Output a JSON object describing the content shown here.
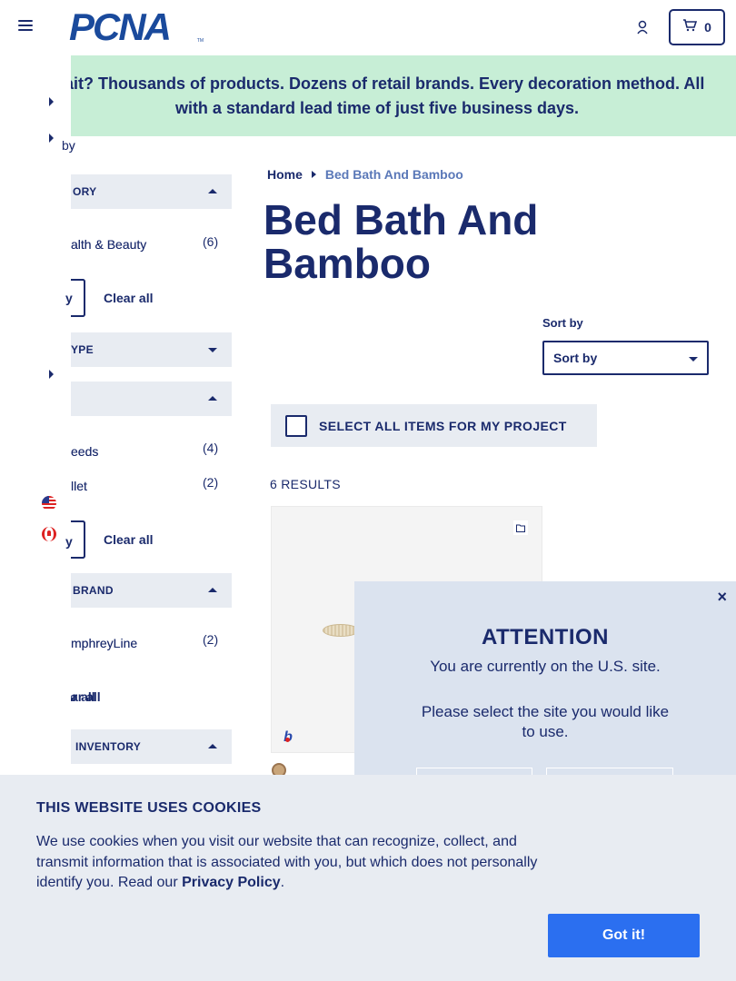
{
  "header": {
    "logo_text": "PCNA",
    "logo_tm": "TM",
    "cart_count": "0"
  },
  "banner": {
    "text": "Wait? Thousands of products. Dozens of retail brands. Every decoration method. All with a standard lead time of just five business days."
  },
  "filters": {
    "sort_fragment": "by",
    "category": {
      "header": "ORY",
      "items": [
        {
          "label": "alth & Beauty",
          "count": "(6)"
        }
      ],
      "apply_fragment": "y",
      "clear_label": "Clear all"
    },
    "type": {
      "header": "YPE"
    },
    "third": {
      "header": "",
      "items": [
        {
          "label": "eeds",
          "count": "(4)"
        },
        {
          "label": "llet",
          "count": "(2)"
        }
      ],
      "apply_fragment": "y",
      "clear_label": "Clear all"
    },
    "brand": {
      "header": "BRAND",
      "items": [
        {
          "label": "mphreyLine",
          "count": "(2)"
        }
      ],
      "clear_label": "ar all"
    },
    "inventory": {
      "header": "INVENTORY"
    }
  },
  "breadcrumb": {
    "home": "Home",
    "current": "Bed Bath And Bamboo"
  },
  "page_title": "Bed Bath And Bamboo",
  "sort": {
    "label": "Sort by",
    "selected": "Sort by"
  },
  "select_all_label": "SELECT ALL ITEMS FOR MY PROJECT",
  "results_text": "6 RESULTS",
  "product": {
    "brand_badge": "b"
  },
  "modal": {
    "title": "ATTENTION",
    "line1": "You are currently on the U.S. site.",
    "line2": "Please select the site you would like to use.",
    "close": "×"
  },
  "cookie": {
    "title": "THIS WEBSITE USES COOKIES",
    "body": "We use cookies when you visit our website that can recognize, collect, and transmit information that is associated with you, but which does not personally identify you. Read our ",
    "link": "Privacy Policy",
    "period": ".",
    "button": "Got it!"
  },
  "colors": {
    "brand_navy": "#1a2a6c",
    "banner_bg": "#c7eed6",
    "filter_bg": "#e8ecf2",
    "modal_bg": "#dbe3ef",
    "accept_button": "#2b6ff0"
  }
}
